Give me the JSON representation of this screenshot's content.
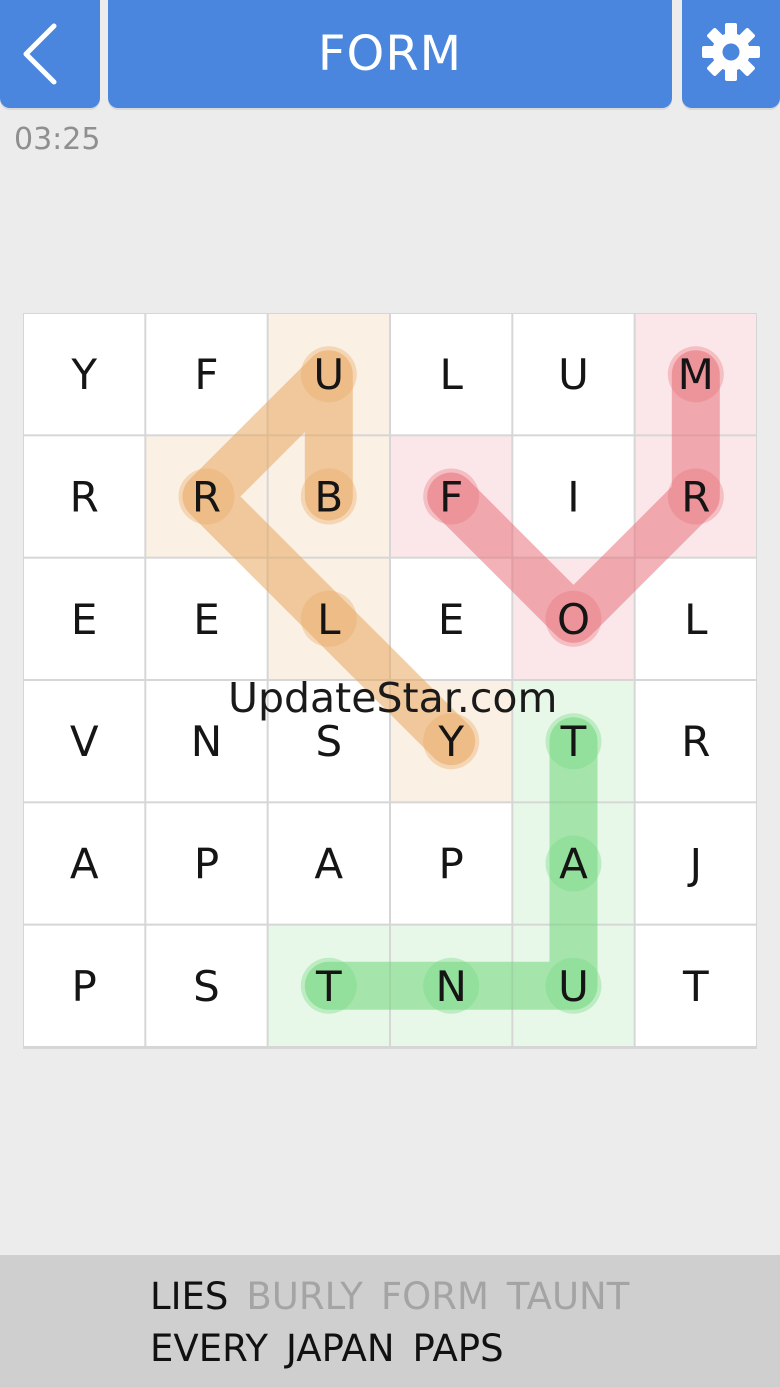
{
  "header": {
    "title": "FORM",
    "back_icon": "chevron-left-icon",
    "settings_icon": "gear-icon",
    "color": "#4a86de"
  },
  "timer": "03:25",
  "grid": {
    "rows": 6,
    "cols": 6,
    "letters": [
      [
        "Y",
        "F",
        "U",
        "L",
        "U",
        "M"
      ],
      [
        "R",
        "R",
        "B",
        "F",
        "I",
        "R"
      ],
      [
        "E",
        "E",
        "L",
        "E",
        "O",
        "L"
      ],
      [
        "V",
        "N",
        "S",
        "Y",
        "T",
        "R"
      ],
      [
        "A",
        "P",
        "A",
        "P",
        "A",
        "J"
      ],
      [
        "P",
        "S",
        "T",
        "N",
        "U",
        "T"
      ]
    ],
    "found_words": [
      {
        "word": "BURLY",
        "color": "#e9a75e",
        "cells": [
          [
            1,
            2
          ],
          [
            0,
            2
          ],
          [
            1,
            1
          ],
          [
            2,
            2
          ],
          [
            3,
            3
          ]
        ]
      },
      {
        "word": "FORM",
        "color": "#e8737b",
        "cells": [
          [
            1,
            3
          ],
          [
            2,
            4
          ],
          [
            1,
            5
          ],
          [
            0,
            5
          ]
        ]
      },
      {
        "word": "TAUNT",
        "color": "#6fd67a",
        "cells": [
          [
            3,
            4
          ],
          [
            4,
            4
          ],
          [
            5,
            4
          ],
          [
            5,
            3
          ],
          [
            5,
            2
          ]
        ]
      }
    ]
  },
  "watermark": "UpdateStar.com",
  "word_list": {
    "rows": [
      [
        {
          "text": "LIES",
          "found": false
        },
        {
          "text": "BURLY",
          "found": true
        },
        {
          "text": "FORM",
          "found": true
        },
        {
          "text": "TAUNT",
          "found": true
        }
      ],
      [
        {
          "text": "EVERY",
          "found": false
        },
        {
          "text": "JAPAN",
          "found": false
        },
        {
          "text": "PAPS",
          "found": false
        }
      ]
    ]
  }
}
